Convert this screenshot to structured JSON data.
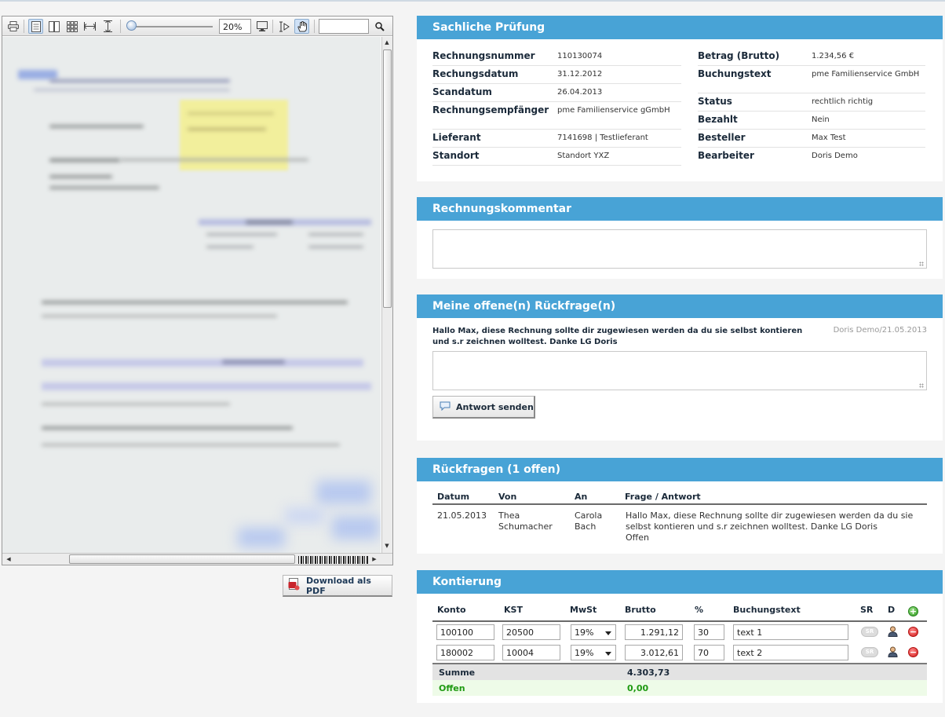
{
  "viewer": {
    "zoom_value": "20%",
    "download_label": "Download als PDF"
  },
  "pruefung": {
    "title": "Sachliche Prüfung",
    "left": [
      {
        "label": "Rechnungsnummer",
        "value": "110130074"
      },
      {
        "label": "Rechungsdatum",
        "value": "31.12.2012"
      },
      {
        "label": "Scandatum",
        "value": "26.04.2013"
      },
      {
        "label": "Rechnungsempfänger",
        "value": "pme Familienservice gGmbH"
      },
      {
        "label": "Lieferant",
        "value": "7141698 | Testlieferant"
      },
      {
        "label": "Standort",
        "value": "Standort YXZ"
      }
    ],
    "right": [
      {
        "label": "Betrag (Brutto)",
        "value": "1.234,56 €"
      },
      {
        "label": "Buchungstext",
        "value": "pme Familienservice GmbH"
      },
      {
        "label": "Status",
        "value": "rechtlich richtig"
      },
      {
        "label": "Bezahlt",
        "value": "Nein"
      },
      {
        "label": "Besteller",
        "value": "Max Test"
      },
      {
        "label": "Bearbeiter",
        "value": "Doris Demo"
      }
    ]
  },
  "kommentar": {
    "title": "Rechnungskommentar",
    "value": ""
  },
  "rueckfrage": {
    "title": "Meine offene(n) Rückfrage(n)",
    "message": "Hallo Max, diese Rechnung sollte dir zugewiesen werden da du sie selbst kontieren und s.r zeichnen wolltest. Danke LG Doris",
    "meta": "Doris Demo/21.05.2013",
    "reply_value": "",
    "send_label": "Antwort senden"
  },
  "rueckfragen": {
    "title": "Rückfragen (1 offen)",
    "headers": [
      "Datum",
      "Von",
      "An",
      "Frage / Antwort"
    ],
    "rows": [
      {
        "datum": "21.05.2013",
        "von": "Thea Schumacher",
        "an": "Carola Bach",
        "frage": "Hallo Max, diese Rechnung sollte dir zugewiesen werden da du sie selbst kontieren und s.r zeichnen wolltest. Danke LG Doris",
        "status": "Offen"
      }
    ]
  },
  "kontierung": {
    "title": "Kontierung",
    "headers": [
      "Konto",
      "KST",
      "MwSt",
      "Brutto",
      "%",
      "Buchungstext",
      "SR",
      "D"
    ],
    "rows": [
      {
        "konto": "100100",
        "kst": "20500",
        "mwst": "19%",
        "brutto": "1.291,12",
        "prozent": "30",
        "text": "text 1",
        "sr": "SR"
      },
      {
        "konto": "180002",
        "kst": "10004",
        "mwst": "19%",
        "brutto": "3.012,61",
        "prozent": "70",
        "text": "text 2",
        "sr": "SR"
      }
    ],
    "summe_label": "Summe",
    "summe_value": "4.303,73",
    "offen_label": "Offen",
    "offen_value": "0,00",
    "colors": {
      "offen_text": "#1f9a12",
      "offen_bg": "#eefbe8",
      "summe_bg": "#e3e3e3"
    }
  },
  "icons": {
    "print": "print-icon",
    "single_page": "single-page-icon",
    "double_page": "double-page-icon",
    "thumbnails": "thumbnails-icon",
    "fit_width": "fit-width-icon",
    "fit_height": "fit-height-icon",
    "fullscreen": "monitor-icon",
    "text_select": "text-select-icon",
    "pan": "hand-icon",
    "search": "magnifier-icon",
    "pdf": "pdf-icon",
    "comment": "speech-bubble-icon",
    "user": "user-icon",
    "remove": "minus-circle-icon",
    "add": "plus-circle-icon"
  }
}
